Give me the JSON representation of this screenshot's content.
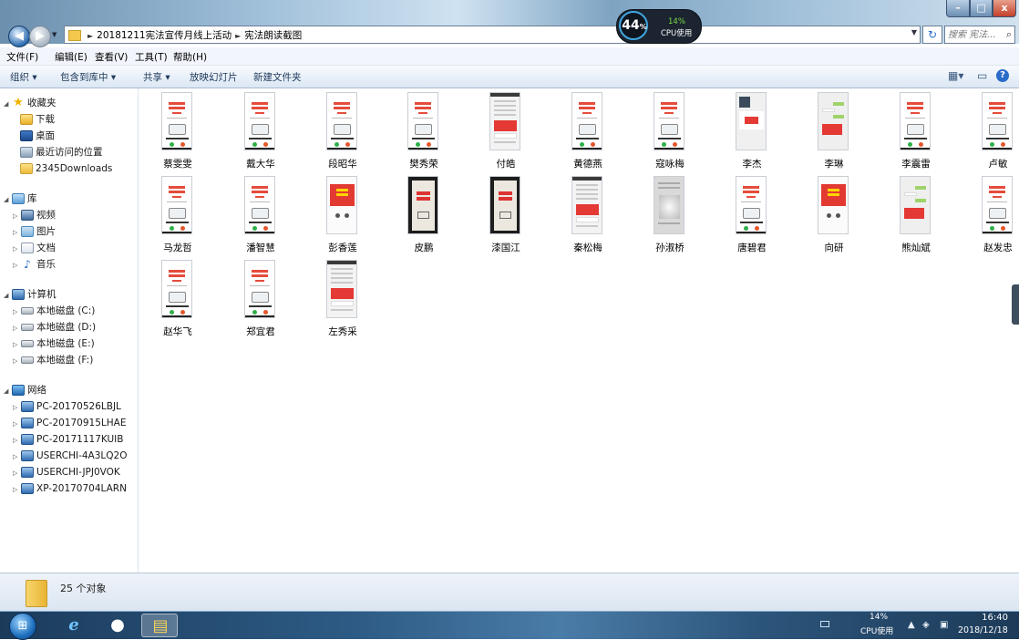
{
  "window": {
    "breadcrumb": [
      "20181211宪法宣传月线上活动",
      "宪法朗读截图"
    ],
    "search_placeholder": "搜索 宪法...",
    "controls": {
      "minimize": "–",
      "maximize": "□",
      "close": "x"
    }
  },
  "cpu_widget": {
    "big": "44",
    "big_unit": "%",
    "percent": "14%",
    "label": "CPU使用"
  },
  "menu": [
    "文件(F)",
    "编辑(E)",
    "查看(V)",
    "工具(T)",
    "帮助(H)"
  ],
  "toolbar": {
    "organize": "组织 ▾",
    "include_in_library": "包含到库中 ▾",
    "share": "共享 ▾",
    "slideshow": "放映幻灯片",
    "new_folder": "新建文件夹"
  },
  "nav": {
    "favorites": {
      "label": "收藏夹",
      "items": [
        {
          "label": "下载",
          "icon": "download-folder-icon"
        },
        {
          "label": "桌面",
          "icon": "desktop-icon"
        },
        {
          "label": "最近访问的位置",
          "icon": "recent-places-icon"
        },
        {
          "label": "2345Downloads",
          "icon": "folder-icon"
        }
      ]
    },
    "libraries": {
      "label": "库",
      "items": [
        {
          "label": "视频",
          "icon": "video-library-icon"
        },
        {
          "label": "图片",
          "icon": "pictures-library-icon"
        },
        {
          "label": "文档",
          "icon": "documents-library-icon"
        },
        {
          "label": "音乐",
          "icon": "music-library-icon"
        }
      ]
    },
    "computer": {
      "label": "计算机",
      "items": [
        {
          "label": "本地磁盘 (C:)",
          "icon": "system-drive-icon"
        },
        {
          "label": "本地磁盘 (D:)",
          "icon": "drive-icon"
        },
        {
          "label": "本地磁盘 (E:)",
          "icon": "drive-icon"
        },
        {
          "label": "本地磁盘 (F:)",
          "icon": "drive-icon"
        }
      ]
    },
    "network": {
      "label": "网络",
      "items": [
        {
          "label": "PC-20170526LBJL",
          "icon": "network-pc-icon"
        },
        {
          "label": "PC-20170915LHAE",
          "icon": "network-pc-icon"
        },
        {
          "label": "PC-20171117KUIB",
          "icon": "network-pc-icon"
        },
        {
          "label": "USERCHI-4A3LQ2O",
          "icon": "network-pc-icon"
        },
        {
          "label": "USERCHI-JPJ0VOK",
          "icon": "network-pc-icon"
        },
        {
          "label": "XP-20170704LARN",
          "icon": "network-pc-icon"
        }
      ]
    }
  },
  "files": [
    {
      "name": "蔡雯雯",
      "thumb": "a"
    },
    {
      "name": "戴大华",
      "thumb": "a"
    },
    {
      "name": "段昭华",
      "thumb": "a"
    },
    {
      "name": "樊秀荣",
      "thumb": "a"
    },
    {
      "name": "付皓",
      "thumb": "b"
    },
    {
      "name": "黄德燕",
      "thumb": "a"
    },
    {
      "name": "寇咏梅",
      "thumb": "a"
    },
    {
      "name": "李杰",
      "thumb": "g"
    },
    {
      "name": "李琳",
      "thumb": "f"
    },
    {
      "name": "李震雷",
      "thumb": "a"
    },
    {
      "name": "卢敏",
      "thumb": "a"
    },
    {
      "name": "马龙哲",
      "thumb": "a"
    },
    {
      "name": "潘智慧",
      "thumb": "a"
    },
    {
      "name": "彭香莲",
      "thumb": "e"
    },
    {
      "name": "皮鹏",
      "thumb": "c"
    },
    {
      "name": "漆国江",
      "thumb": "c"
    },
    {
      "name": "秦松梅",
      "thumb": "b"
    },
    {
      "name": "孙淑桥",
      "thumb": "d"
    },
    {
      "name": "唐碧君",
      "thumb": "a"
    },
    {
      "name": "向研",
      "thumb": "e"
    },
    {
      "name": "熊灿斌",
      "thumb": "f"
    },
    {
      "name": "赵发忠",
      "thumb": "a"
    },
    {
      "name": "赵华飞",
      "thumb": "a"
    },
    {
      "name": "郑宜君",
      "thumb": "a"
    },
    {
      "name": "左秀采",
      "thumb": "b"
    }
  ],
  "status": {
    "count": "25 个对象"
  },
  "taskbar": {
    "apps": [
      {
        "name": "internet-explorer",
        "glyph": "e"
      },
      {
        "name": "qq",
        "glyph": "●"
      },
      {
        "name": "windows-explorer",
        "glyph": "▤"
      }
    ],
    "cpu_percent": "14%",
    "cpu_label": "CPU使用",
    "time": "16:40",
    "date": "2018/12/18"
  }
}
